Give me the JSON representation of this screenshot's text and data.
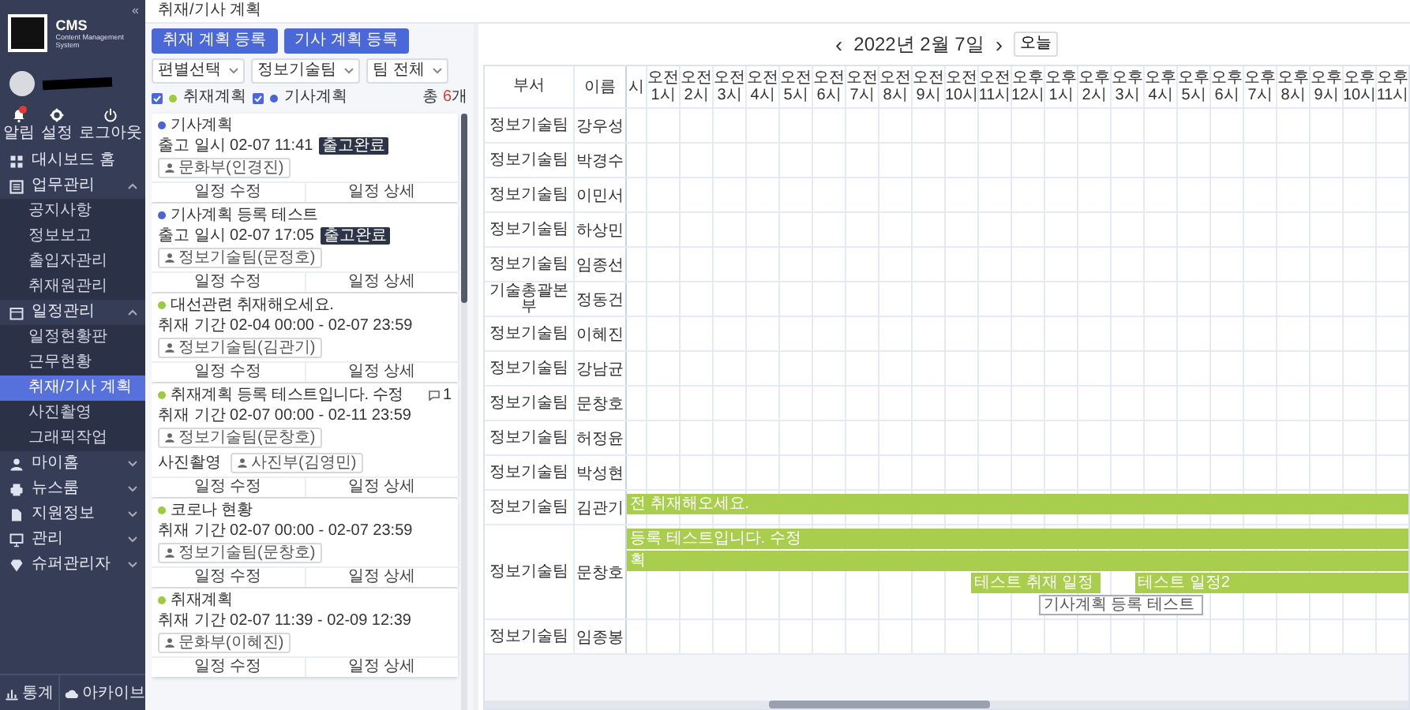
{
  "sidebar": {
    "logo_title": "CMS",
    "logo_subtitle": "Content Management System",
    "collapse": "«",
    "quick_actions": [
      {
        "label": "알림",
        "alert": true
      },
      {
        "label": "설정"
      },
      {
        "label": "로그아웃"
      }
    ],
    "menu": [
      {
        "label": "대시보드 홈"
      },
      {
        "label": "업무관리",
        "expanded": true,
        "children": [
          {
            "label": "공지사항",
            "selected": false
          },
          {
            "label": "정보보고",
            "selected": false
          },
          {
            "label": "출입자관리",
            "selected": false
          },
          {
            "label": "취재원관리",
            "selected": false
          }
        ]
      },
      {
        "label": "일정관리",
        "expanded": true,
        "children": [
          {
            "label": "일정현황판",
            "selected": false
          },
          {
            "label": "근무현황",
            "selected": false
          },
          {
            "label": "취재/기사 계획",
            "selected": true
          },
          {
            "label": "사진촬영",
            "selected": false
          },
          {
            "label": "그래픽작업",
            "selected": false
          }
        ]
      },
      {
        "label": "마이홈",
        "expanded": false
      },
      {
        "label": "뉴스룸",
        "expanded": false
      },
      {
        "label": "지원정보",
        "expanded": false
      },
      {
        "label": "관리",
        "expanded": false
      },
      {
        "label": "슈퍼관리자",
        "expanded": false
      }
    ],
    "footer": [
      {
        "label": "통계"
      },
      {
        "label": "아카이브"
      }
    ]
  },
  "page_title": "취재/기사 계획",
  "plan_panel": {
    "buttons": [
      "취재 계획 등록",
      "기사 계획 등록"
    ],
    "filters": [
      {
        "value": "편별선택"
      },
      {
        "value": "정보기술팀"
      },
      {
        "value": "팀 전체"
      }
    ],
    "legend": [
      {
        "label": "취재계획",
        "checked": true,
        "color": "#9ccc3c"
      },
      {
        "label": "기사계획",
        "checked": true,
        "color": "#4a63d6"
      }
    ],
    "total": {
      "prefix": "총 ",
      "count": "6",
      "suffix": "개"
    },
    "cards": [
      {
        "color": "#4a63d6",
        "title": "기사계획",
        "date": "출고 일시 02-07 11:41",
        "status": "출고완료",
        "assignees": [
          {
            "name": "문화부(인경진)"
          }
        ],
        "buttons": [
          "일정 수정",
          "일정 상세"
        ]
      },
      {
        "color": "#4a63d6",
        "title": "기사계획 등록 테스트",
        "date": "출고 일시 02-07 17:05",
        "status": "출고완료",
        "assignees": [
          {
            "name": "정보기술팀(문정호)"
          }
        ],
        "buttons": [
          "일정 수정",
          "일정 상세"
        ]
      },
      {
        "color": "#9ccc3c",
        "title": "대선관련 취재해오세요.",
        "date": "취재 기간 02-04 00:00 - 02-07 23:59",
        "assignees": [
          {
            "name": "정보기술팀(김관기)"
          }
        ],
        "buttons": [
          "일정 수정",
          "일정 상세"
        ]
      },
      {
        "color": "#9ccc3c",
        "title": "취재계획 등록 테스트입니다. 수정",
        "comments": "1",
        "date": "취재 기간 02-07 00:00 - 02-11 23:59",
        "assignees": [
          {
            "name": "정보기술팀(문창호)"
          },
          {
            "role": "사진촬영",
            "name": "사진부(김영민)"
          }
        ],
        "buttons": [
          "일정 수정",
          "일정 상세"
        ]
      },
      {
        "color": "#9ccc3c",
        "title": "코로나 현황",
        "date": "취재 기간 02-07 00:00 - 02-07 23:59",
        "assignees": [
          {
            "name": "정보기술팀(문창호)"
          }
        ],
        "buttons": [
          "일정 수정",
          "일정 상세"
        ]
      },
      {
        "color": "#9ccc3c",
        "title": "취재계획",
        "date": "취재 기간 02-07 11:39 - 02-09 12:39",
        "assignees": [
          {
            "name": "문화부(이혜진)"
          }
        ],
        "buttons": [
          "일정 수정",
          "일정 상세"
        ]
      }
    ]
  },
  "calendar": {
    "prev": "‹",
    "date": "2022년 2월 7일",
    "next": "›",
    "today": "오늘",
    "columns": [
      "부서",
      "이름"
    ],
    "hours": [
      "시",
      "오전 1시",
      "오전 2시",
      "오전 3시",
      "오전 4시",
      "오전 5시",
      "오전 6시",
      "오전 7시",
      "오전 8시",
      "오전 9시",
      "오전 10시",
      "오전 11시",
      "오후 12시",
      "오후 1시",
      "오후 2시",
      "오후 3시",
      "오후 4시",
      "오후 5시",
      "오후 6시",
      "오후 7시",
      "오후 8시",
      "오후 9시",
      "오후 10시",
      "오후 11시"
    ],
    "rows": [
      {
        "dept": "정보기술팀",
        "name": "강우성"
      },
      {
        "dept": "정보기술팀",
        "name": "박경수"
      },
      {
        "dept": "정보기술팀",
        "name": "이민서"
      },
      {
        "dept": "정보기술팀",
        "name": "하상민"
      },
      {
        "dept": "정보기술팀",
        "name": "임종선"
      },
      {
        "dept": "기술총괄본부",
        "name": "정동건"
      },
      {
        "dept": "정보기술팀",
        "name": "이혜진"
      },
      {
        "dept": "정보기술팀",
        "name": "강남균"
      },
      {
        "dept": "정보기술팀",
        "name": "문창호"
      },
      {
        "dept": "정보기술팀",
        "name": "허정윤"
      },
      {
        "dept": "정보기술팀",
        "name": "박성현"
      },
      {
        "dept": "정보기술팀",
        "name": "김관기",
        "lanes": [
          [
            {
              "kind": "filled",
              "label": "전 취재해오세요.",
              "open_end": true
            }
          ]
        ]
      },
      {
        "dept": "정보기술팀",
        "name": "문창호",
        "lanes": [
          [
            {
              "kind": "filled",
              "label": "등록 테스트입니다. 수정",
              "open_end": true
            }
          ],
          [
            {
              "kind": "filled",
              "label": "획",
              "open_end": true
            }
          ],
          [
            {
              "kind": "wide-gap"
            },
            {
              "kind": "filled",
              "label": "테스트 취재 일정",
              "open_end": false
            },
            {
              "kind": "narrow-gap"
            },
            {
              "kind": "filled",
              "label": "테스트 일정2",
              "open_end": true
            }
          ],
          [
            {
              "kind": "wide-gap"
            },
            {
              "kind": "outline",
              "label": "기사계획 등록 테스트",
              "open_end": false
            },
            {
              "kind": "medium-gap"
            }
          ]
        ]
      },
      {
        "dept": "정보기술팀",
        "name": "임종봉"
      }
    ]
  }
}
